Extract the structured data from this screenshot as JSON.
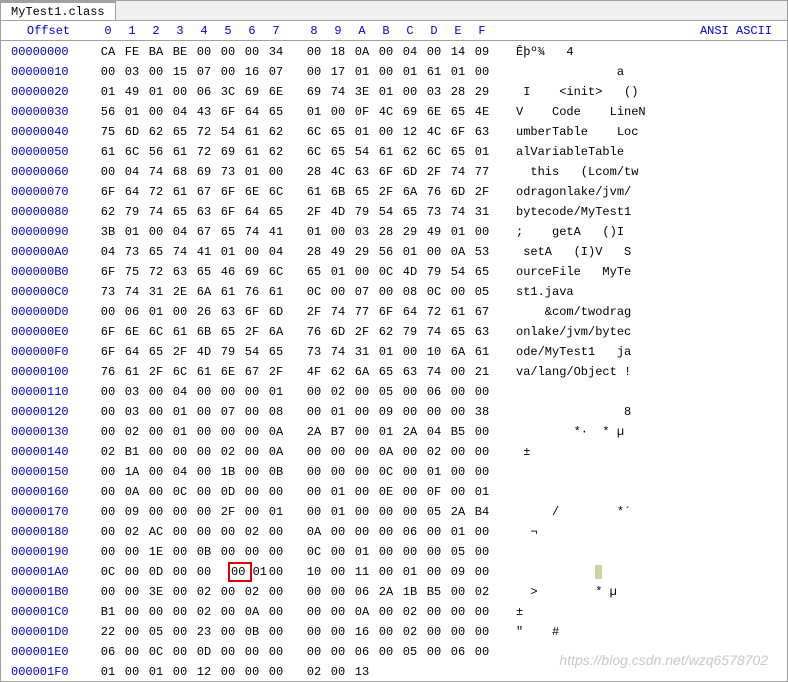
{
  "tab": {
    "title": "MyTest1.class"
  },
  "header": {
    "offset_label": "Offset",
    "cols": [
      "0",
      "1",
      "2",
      "3",
      "4",
      "5",
      "6",
      "7",
      "8",
      "9",
      "A",
      "B",
      "C",
      "D",
      "E",
      "F"
    ],
    "ansi_label": "ANSI ASCII"
  },
  "rows": [
    {
      "offset": "00000000",
      "hex": [
        "CA",
        "FE",
        "BA",
        "BE",
        "00",
        "00",
        "00",
        "34",
        "00",
        "18",
        "0A",
        "00",
        "04",
        "00",
        "14",
        "09"
      ],
      "ansi": "Êþº¾   4"
    },
    {
      "offset": "00000010",
      "hex": [
        "00",
        "03",
        "00",
        "15",
        "07",
        "00",
        "16",
        "07",
        "00",
        "17",
        "01",
        "00",
        "01",
        "61",
        "01",
        "00"
      ],
      "ansi": "              a"
    },
    {
      "offset": "00000020",
      "hex": [
        "01",
        "49",
        "01",
        "00",
        "06",
        "3C",
        "69",
        "6E",
        "69",
        "74",
        "3E",
        "01",
        "00",
        "03",
        "28",
        "29"
      ],
      "ansi": " I    <init>   ()"
    },
    {
      "offset": "00000030",
      "hex": [
        "56",
        "01",
        "00",
        "04",
        "43",
        "6F",
        "64",
        "65",
        "01",
        "00",
        "0F",
        "4C",
        "69",
        "6E",
        "65",
        "4E"
      ],
      "ansi": "V    Code    LineN"
    },
    {
      "offset": "00000040",
      "hex": [
        "75",
        "6D",
        "62",
        "65",
        "72",
        "54",
        "61",
        "62",
        "6C",
        "65",
        "01",
        "00",
        "12",
        "4C",
        "6F",
        "63"
      ],
      "ansi": "umberTable    Loc"
    },
    {
      "offset": "00000050",
      "hex": [
        "61",
        "6C",
        "56",
        "61",
        "72",
        "69",
        "61",
        "62",
        "6C",
        "65",
        "54",
        "61",
        "62",
        "6C",
        "65",
        "01"
      ],
      "ansi": "alVariableTable"
    },
    {
      "offset": "00000060",
      "hex": [
        "00",
        "04",
        "74",
        "68",
        "69",
        "73",
        "01",
        "00",
        "28",
        "4C",
        "63",
        "6F",
        "6D",
        "2F",
        "74",
        "77"
      ],
      "ansi": "  this   (Lcom/tw"
    },
    {
      "offset": "00000070",
      "hex": [
        "6F",
        "64",
        "72",
        "61",
        "67",
        "6F",
        "6E",
        "6C",
        "61",
        "6B",
        "65",
        "2F",
        "6A",
        "76",
        "6D",
        "2F"
      ],
      "ansi": "odragonlake/jvm/"
    },
    {
      "offset": "00000080",
      "hex": [
        "62",
        "79",
        "74",
        "65",
        "63",
        "6F",
        "64",
        "65",
        "2F",
        "4D",
        "79",
        "54",
        "65",
        "73",
        "74",
        "31"
      ],
      "ansi": "bytecode/MyTest1"
    },
    {
      "offset": "00000090",
      "hex": [
        "3B",
        "01",
        "00",
        "04",
        "67",
        "65",
        "74",
        "41",
        "01",
        "00",
        "03",
        "28",
        "29",
        "49",
        "01",
        "00"
      ],
      "ansi": ";    getA   ()I"
    },
    {
      "offset": "000000A0",
      "hex": [
        "04",
        "73",
        "65",
        "74",
        "41",
        "01",
        "00",
        "04",
        "28",
        "49",
        "29",
        "56",
        "01",
        "00",
        "0A",
        "53"
      ],
      "ansi": " setA   (I)V   S"
    },
    {
      "offset": "000000B0",
      "hex": [
        "6F",
        "75",
        "72",
        "63",
        "65",
        "46",
        "69",
        "6C",
        "65",
        "01",
        "00",
        "0C",
        "4D",
        "79",
        "54",
        "65"
      ],
      "ansi": "ourceFile   MyTe"
    },
    {
      "offset": "000000C0",
      "hex": [
        "73",
        "74",
        "31",
        "2E",
        "6A",
        "61",
        "76",
        "61",
        "0C",
        "00",
        "07",
        "00",
        "08",
        "0C",
        "00",
        "05"
      ],
      "ansi": "st1.java"
    },
    {
      "offset": "000000D0",
      "hex": [
        "00",
        "06",
        "01",
        "00",
        "26",
        "63",
        "6F",
        "6D",
        "2F",
        "74",
        "77",
        "6F",
        "64",
        "72",
        "61",
        "67"
      ],
      "ansi": "    &com/twodrag"
    },
    {
      "offset": "000000E0",
      "hex": [
        "6F",
        "6E",
        "6C",
        "61",
        "6B",
        "65",
        "2F",
        "6A",
        "76",
        "6D",
        "2F",
        "62",
        "79",
        "74",
        "65",
        "63"
      ],
      "ansi": "onlake/jvm/bytec"
    },
    {
      "offset": "000000F0",
      "hex": [
        "6F",
        "64",
        "65",
        "2F",
        "4D",
        "79",
        "54",
        "65",
        "73",
        "74",
        "31",
        "01",
        "00",
        "10",
        "6A",
        "61"
      ],
      "ansi": "ode/MyTest1   ja"
    },
    {
      "offset": "00000100",
      "hex": [
        "76",
        "61",
        "2F",
        "6C",
        "61",
        "6E",
        "67",
        "2F",
        "4F",
        "62",
        "6A",
        "65",
        "63",
        "74",
        "00",
        "21"
      ],
      "ansi": "va/lang/Object !"
    },
    {
      "offset": "00000110",
      "hex": [
        "00",
        "03",
        "00",
        "04",
        "00",
        "00",
        "00",
        "01",
        "00",
        "02",
        "00",
        "05",
        "00",
        "06",
        "00",
        "00"
      ],
      "ansi": ""
    },
    {
      "offset": "00000120",
      "hex": [
        "00",
        "03",
        "00",
        "01",
        "00",
        "07",
        "00",
        "08",
        "00",
        "01",
        "00",
        "09",
        "00",
        "00",
        "00",
        "38"
      ],
      "ansi": "               8"
    },
    {
      "offset": "00000130",
      "hex": [
        "00",
        "02",
        "00",
        "01",
        "00",
        "00",
        "00",
        "0A",
        "2A",
        "B7",
        "00",
        "01",
        "2A",
        "04",
        "B5",
        "00"
      ],
      "ansi": "        *·  * µ"
    },
    {
      "offset": "00000140",
      "hex": [
        "02",
        "B1",
        "00",
        "00",
        "00",
        "02",
        "00",
        "0A",
        "00",
        "00",
        "00",
        "0A",
        "00",
        "02",
        "00",
        "00"
      ],
      "ansi": " ±"
    },
    {
      "offset": "00000150",
      "hex": [
        "00",
        "1A",
        "00",
        "04",
        "00",
        "1B",
        "00",
        "0B",
        "00",
        "00",
        "00",
        "0C",
        "00",
        "01",
        "00",
        "00"
      ],
      "ansi": ""
    },
    {
      "offset": "00000160",
      "hex": [
        "00",
        "0A",
        "00",
        "0C",
        "00",
        "0D",
        "00",
        "00",
        "00",
        "01",
        "00",
        "0E",
        "00",
        "0F",
        "00",
        "01"
      ],
      "ansi": ""
    },
    {
      "offset": "00000170",
      "hex": [
        "00",
        "09",
        "00",
        "00",
        "00",
        "2F",
        "00",
        "01",
        "00",
        "01",
        "00",
        "00",
        "00",
        "05",
        "2A",
        "B4"
      ],
      "ansi": "     /        *´"
    },
    {
      "offset": "00000180",
      "hex": [
        "00",
        "02",
        "AC",
        "00",
        "00",
        "00",
        "02",
        "00",
        "0A",
        "00",
        "00",
        "00",
        "06",
        "00",
        "01",
        "00"
      ],
      "ansi": "  ¬"
    },
    {
      "offset": "00000190",
      "hex": [
        "00",
        "00",
        "1E",
        "00",
        "0B",
        "00",
        "00",
        "00",
        "0C",
        "00",
        "01",
        "00",
        "00",
        "00",
        "05",
        "00"
      ],
      "ansi": ""
    },
    {
      "offset": "000001A0",
      "hex": [
        "0C",
        "00",
        "0D",
        "00",
        "00",
        "00",
        "01",
        "00",
        "10",
        "00",
        "11",
        "00",
        "01",
        "00",
        "09",
        "00"
      ],
      "ansi": ""
    },
    {
      "offset": "000001B0",
      "hex": [
        "00",
        "00",
        "3E",
        "00",
        "02",
        "00",
        "02",
        "00",
        "00",
        "00",
        "06",
        "2A",
        "1B",
        "B5",
        "00",
        "02"
      ],
      "ansi": "  >        * µ"
    },
    {
      "offset": "000001C0",
      "hex": [
        "B1",
        "00",
        "00",
        "00",
        "02",
        "00",
        "0A",
        "00",
        "00",
        "00",
        "0A",
        "00",
        "02",
        "00",
        "00",
        "00"
      ],
      "ansi": "±"
    },
    {
      "offset": "000001D0",
      "hex": [
        "22",
        "00",
        "05",
        "00",
        "23",
        "00",
        "0B",
        "00",
        "00",
        "00",
        "16",
        "00",
        "02",
        "00",
        "00",
        "00"
      ],
      "ansi": "\"    #"
    },
    {
      "offset": "000001E0",
      "hex": [
        "06",
        "00",
        "0C",
        "00",
        "0D",
        "00",
        "00",
        "00",
        "00",
        "00",
        "06",
        "00",
        "05",
        "00",
        "06",
        "00"
      ],
      "ansi": ""
    },
    {
      "offset": "000001F0",
      "hex": [
        "01",
        "00",
        "01",
        "00",
        "12",
        "00",
        "00",
        "00",
        "02",
        "00",
        "13"
      ],
      "ansi": ""
    }
  ],
  "highlight": {
    "row": 26,
    "start": 5,
    "end": 6
  },
  "ansi_highlight": {
    "row": 26,
    "col": 11
  },
  "watermark": "https://blog.csdn.net/wzq6578702"
}
